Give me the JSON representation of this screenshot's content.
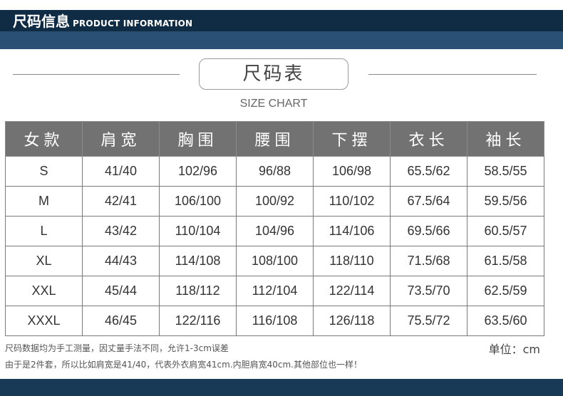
{
  "header": {
    "title_cn": "尺码信息",
    "title_en": "PRODUCT INFORMATION"
  },
  "chart": {
    "title": "尺码表",
    "subtitle": "SIZE CHART"
  },
  "table": {
    "columns": [
      "女款",
      "肩宽",
      "胸围",
      "腰围",
      "下摆",
      "衣长",
      "袖长"
    ],
    "rows": [
      [
        "S",
        "41/40",
        "102/96",
        "96/88",
        "106/98",
        "65.5/62",
        "58.5/55"
      ],
      [
        "M",
        "42/41",
        "106/100",
        "100/92",
        "110/102",
        "67.5/64",
        "59.5/56"
      ],
      [
        "L",
        "43/42",
        "110/104",
        "104/96",
        "114/106",
        "69.5/66",
        "60.5/57"
      ],
      [
        "XL",
        "44/43",
        "114/108",
        "108/100",
        "118/110",
        "71.5/68",
        "61.5/58"
      ],
      [
        "XXL",
        "45/44",
        "118/112",
        "112/104",
        "122/114",
        "73.5/70",
        "62.5/59"
      ],
      [
        "XXXL",
        "46/45",
        "122/116",
        "116/108",
        "126/118",
        "75.5/72",
        "63.5/60"
      ]
    ]
  },
  "notes": {
    "line1": "尺码数据均为手工测量，因丈量手法不同，允许1-3cm误差",
    "line2": "由于是2件套，所以比如肩宽是41/40，代表外衣肩宽41cm.内胆肩宽40cm.其他部位也一样！",
    "unit": "单位：cm"
  }
}
